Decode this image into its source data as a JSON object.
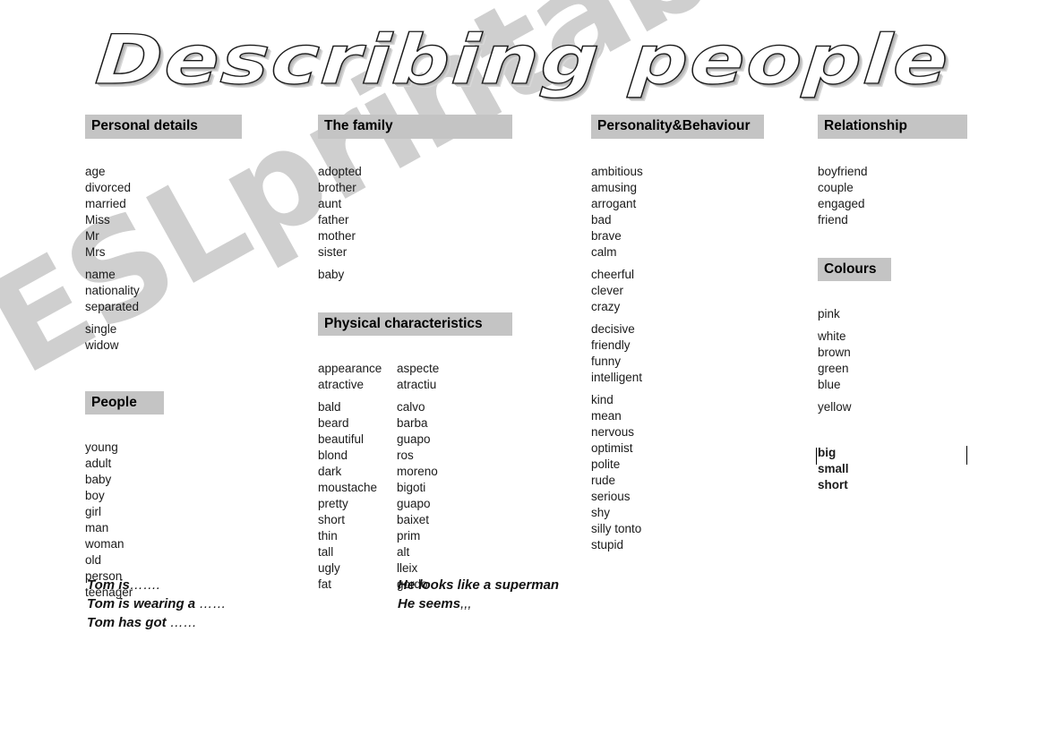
{
  "title": "Describing people",
  "watermark": "ESLprintables.com",
  "columns": {
    "personal_details": {
      "heading": "Personal details",
      "groups": [
        [
          "age",
          "divorced",
          "married",
          "Miss",
          "Mr",
          "Mrs"
        ],
        [
          "name",
          "nationality",
          "separated"
        ],
        [
          "single",
          "widow"
        ]
      ]
    },
    "people": {
      "heading": "People",
      "groups": [
        [
          "young",
          "adult",
          "baby",
          "boy",
          "girl",
          "man",
          "woman",
          "old",
          "person",
          "teenager"
        ]
      ]
    },
    "the_family": {
      "heading": "The family",
      "groups": [
        [
          "adopted",
          "brother",
          "aunt",
          "father",
          "mother",
          "sister"
        ],
        [
          "baby"
        ]
      ]
    },
    "physical_characteristics": {
      "heading": "Physical characteristics",
      "pair_groups": [
        [
          {
            "en": "appearance",
            "tr": "aspecte"
          },
          {
            "en": "atractive",
            "tr": "atractiu"
          }
        ],
        [
          {
            "en": "bald",
            "tr": "calvo"
          },
          {
            "en": "beard",
            "tr": "barba"
          },
          {
            "en": "beautiful",
            "tr": "guapo"
          },
          {
            "en": "blond",
            "tr": "ros"
          },
          {
            "en": "dark",
            "tr": "moreno"
          },
          {
            "en": "moustache",
            "tr": "bigoti"
          },
          {
            "en": "pretty",
            "tr": "guapo"
          },
          {
            "en": "short",
            "tr": "baixet"
          },
          {
            "en": "thin",
            "tr": "prim"
          },
          {
            "en": "tall",
            "tr": "alt"
          },
          {
            "en": "ugly",
            "tr": "lleix"
          },
          {
            "en": "fat",
            "tr": "gordo"
          }
        ]
      ]
    },
    "personality_behaviour": {
      "heading": "Personality&Behaviour",
      "groups": [
        [
          "ambitious",
          "amusing",
          "arrogant",
          "bad",
          "brave",
          "calm"
        ],
        [
          "cheerful",
          "clever",
          "crazy"
        ],
        [
          "decisive",
          "friendly",
          "funny",
          "intelligent"
        ],
        [
          "kind",
          "mean",
          "nervous",
          "optimist",
          "polite",
          "rude",
          "serious",
          "shy",
          "silly tonto",
          "stupid"
        ]
      ]
    },
    "relationship": {
      "heading": "Relationship",
      "groups": [
        [
          "boyfriend",
          "couple",
          "engaged",
          "friend"
        ]
      ]
    },
    "colours": {
      "heading": "Colours",
      "groups": [
        [
          "pink"
        ],
        [
          "white",
          "brown",
          "green",
          "blue"
        ],
        [
          "yellow"
        ]
      ]
    },
    "sizes": {
      "items": [
        "big",
        "small",
        "short"
      ]
    }
  },
  "sentences": {
    "left": [
      {
        "text": "Tom is",
        "dots": "……."
      },
      {
        "text": "Tom is wearing a ",
        "dots": "……"
      },
      {
        "text": "Tom has got ",
        "dots": "……"
      }
    ],
    "right": [
      {
        "text": "He looks like a superman",
        "dots": ""
      },
      {
        "text": "He seems",
        "dots": ",,,"
      }
    ]
  },
  "colors": {
    "heading_bar": "#c4c4c4",
    "text": "#1b1b1b",
    "watermark": "#cfcfcf"
  }
}
